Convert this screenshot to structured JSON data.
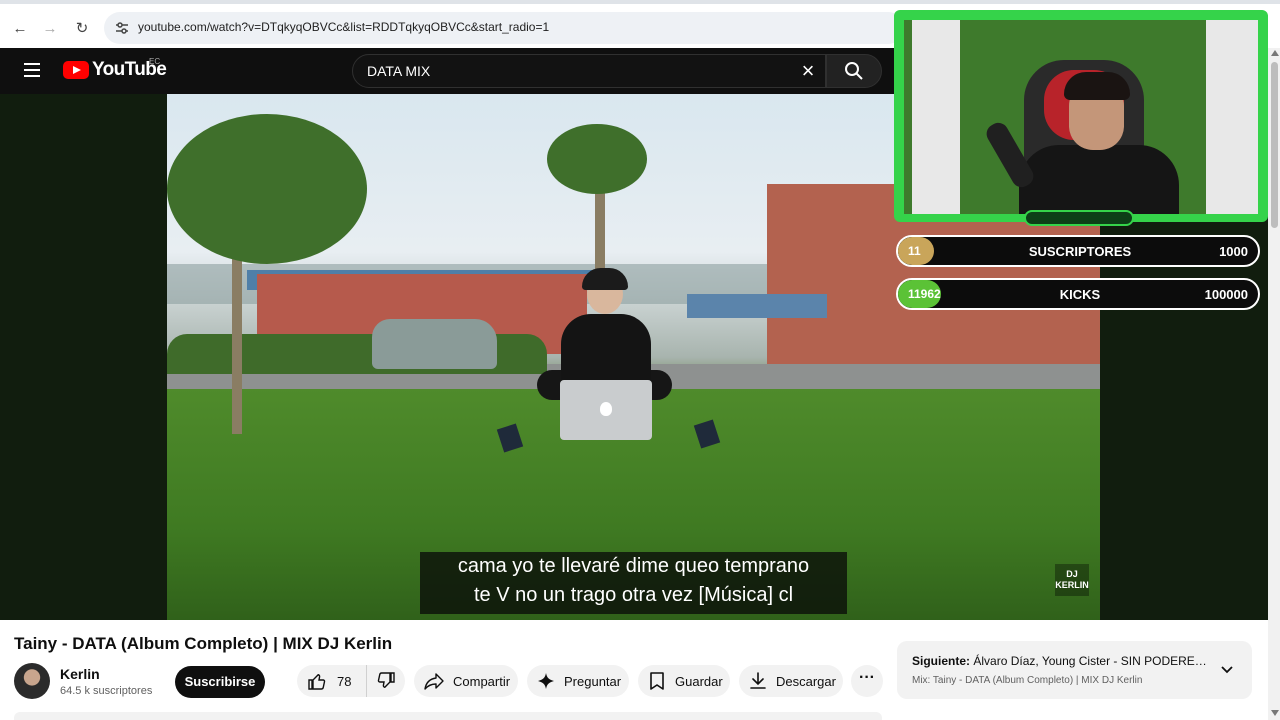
{
  "browser": {
    "url": "youtube.com/watch?v=DTqkyqOBVCc&list=RDDTqkyqOBVCc&start_radio=1",
    "back_icon": "←",
    "forward_icon": "→",
    "reload_icon": "↻"
  },
  "header": {
    "logo_text": "YouTube",
    "region": "EC",
    "search_value": "DATA MIX",
    "clear_icon": "×"
  },
  "video": {
    "subtitle_line1": "cama yo te llevaré dime queo temprano",
    "subtitle_line2": "te V no un trago otra vez [Música] cl",
    "watermark_line1": "DJ",
    "watermark_line2": "KERLIN"
  },
  "overlay": {
    "goals": [
      {
        "count": "11",
        "label": "SUSCRIPTORES",
        "target": "1000",
        "progress": 0.011,
        "color": "#c9a55a"
      },
      {
        "count": "11962",
        "label": "KICKS",
        "target": "100000",
        "progress": 0.12,
        "color": "#5bc236"
      }
    ]
  },
  "details": {
    "title": "Tainy - DATA (Album Completo) | MIX DJ Kerlin",
    "channel_name": "Kerlin",
    "subscriber_count": "64.5 k suscriptores",
    "subscribe_label": "Suscribirse",
    "like_count": "78",
    "share_label": "Compartir",
    "ask_label": "Preguntar",
    "save_label": "Guardar",
    "download_label": "Descargar",
    "more_label": "···"
  },
  "next_up": {
    "label": "Siguiente:",
    "title": "Álvaro Díaz, Young Cister - SIN PODERES...",
    "playlist": "Mix: Tainy - DATA (Album Completo) | MIX DJ Kerlin"
  }
}
